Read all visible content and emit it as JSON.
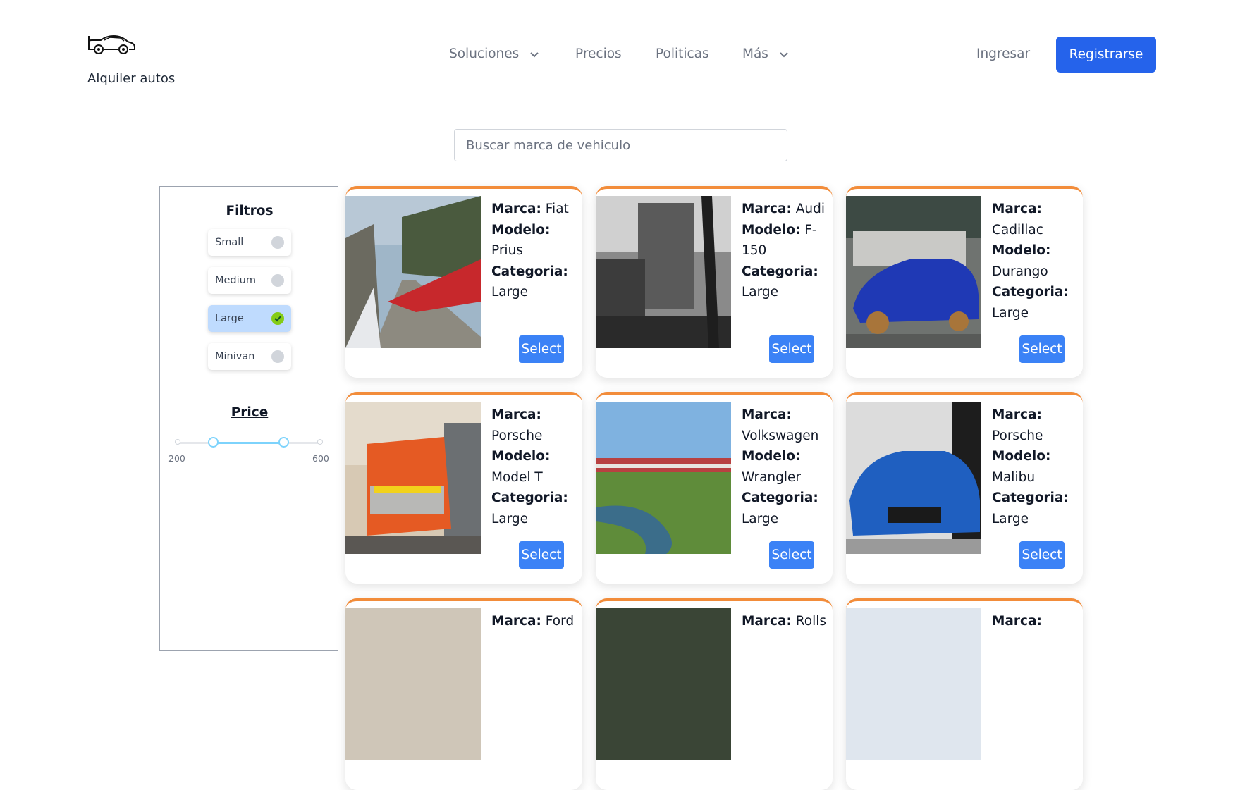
{
  "header": {
    "brand": "Alquiler autos",
    "nav": [
      "Soluciones",
      "Precios",
      "Politicas",
      "Más"
    ],
    "login": "Ingresar",
    "signup": "Registrarse"
  },
  "search": {
    "placeholder": "Buscar marca de vehiculo"
  },
  "filters": {
    "title": "Filtros",
    "sizes": [
      {
        "label": "Small",
        "checked": false
      },
      {
        "label": "Medium",
        "checked": false
      },
      {
        "label": "Large",
        "checked": true
      },
      {
        "label": "Minivan",
        "checked": false
      }
    ],
    "price_title": "Price",
    "price_min": "200",
    "price_max": "600"
  },
  "cards": [
    {
      "marca": "Fiat",
      "modelo": "Prius",
      "categoria": "Large",
      "image": "red-train-photo"
    },
    {
      "marca": "Audi",
      "modelo": "F-150",
      "categoria": "Large",
      "image": "bw-street-photo"
    },
    {
      "marca": "Cadillac",
      "modelo": "Durango",
      "categoria": "Large",
      "image": "blue-sports-car-photo"
    },
    {
      "marca": "Porsche",
      "modelo": "Model T",
      "categoria": "Large",
      "image": "orange-truck-photo"
    },
    {
      "marca": "Volkswagen",
      "modelo": "Wrangler",
      "categoria": "Large",
      "image": "train-field-photo"
    },
    {
      "marca": "Porsche",
      "modelo": "Malibu",
      "categoria": "Large",
      "image": "blue-roadster-photo"
    },
    {
      "marca": "Ford",
      "modelo": "",
      "categoria": "",
      "image": "interior-photo"
    },
    {
      "marca": "Rolls",
      "modelo": "",
      "categoria": "",
      "image": "dark-photo"
    },
    {
      "marca": "",
      "modelo": "",
      "categoria": "",
      "image": "building-photo"
    }
  ],
  "labels": {
    "marca": "Marca:",
    "modelo": "Modelo:",
    "categoria": "Categoria:",
    "select": "Select"
  },
  "colors": {
    "primary": "#2563eb",
    "select": "#3b82f6",
    "card_accent": "#f28c3a",
    "active_filter": "#bfdbfe",
    "check": "#84cc16"
  }
}
